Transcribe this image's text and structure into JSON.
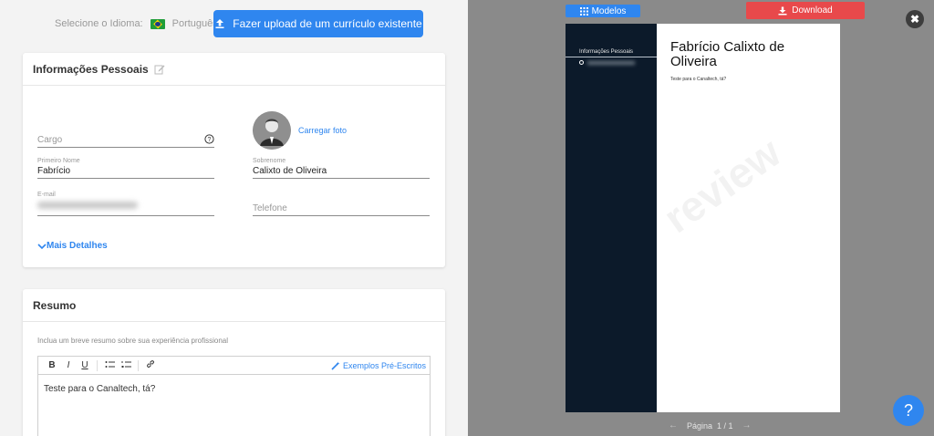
{
  "header": {
    "language_label": "Selecione o Idioma:",
    "language_value": "Português",
    "upload_button": "Fazer upload de um currículo existente"
  },
  "personal": {
    "title": "Informações Pessoais",
    "upload_photo": "Carregar foto",
    "job_title_placeholder": "Cargo",
    "first_name_label": "Primeiro Nome",
    "first_name_value": "Fabrício",
    "last_name_label": "Sobrenome",
    "last_name_value": "Calixto de Oliveira",
    "email_label": "E-mail",
    "phone_placeholder": "Telefone",
    "more_details": "Mais Detalhes"
  },
  "summary": {
    "title": "Resumo",
    "hint": "Inclua um breve resumo sobre sua experiência profissional",
    "toolbar": {
      "bold": "B",
      "italic": "I",
      "underline": "U"
    },
    "examples": "Exemplos Pré-Escritos",
    "text": "Teste para o Canaltech, tá?"
  },
  "preview": {
    "models_button": "Modelos",
    "download_button": "Download",
    "close": "✖",
    "sidebar_heading": "Informações Pessoais",
    "name": "Fabrício Calixto de Oliveira",
    "summary": "Teste para o Canaltech, tá?",
    "watermark": "review",
    "page_label": "Página",
    "page_value": "1 / 1",
    "help": "?"
  },
  "colors": {
    "accent": "#2f86ef",
    "download": "#e8494b",
    "sidebar": "#0c1a2a"
  }
}
